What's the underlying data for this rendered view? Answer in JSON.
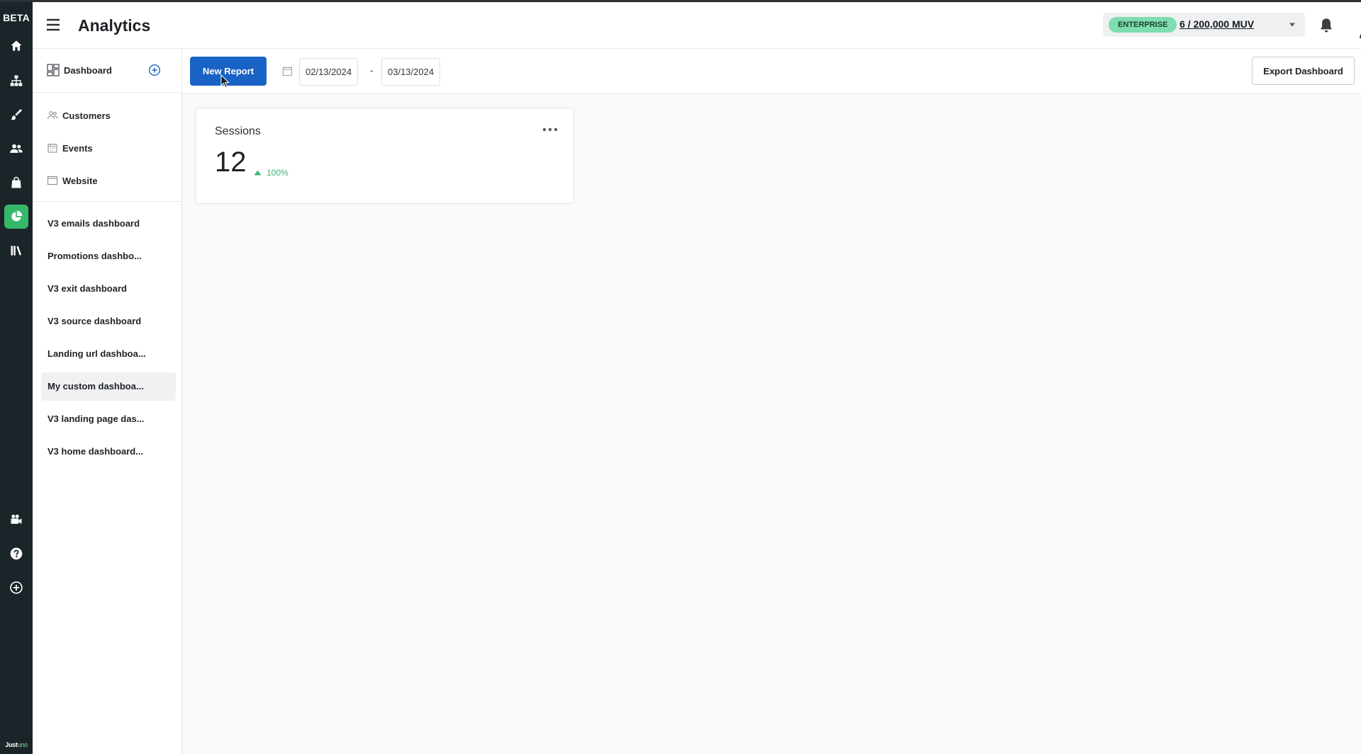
{
  "rail": {
    "beta_label": "BETA",
    "items": [
      {
        "icon": "home-icon"
      },
      {
        "icon": "sitemap-icon"
      },
      {
        "icon": "brush-icon"
      },
      {
        "icon": "users-icon"
      },
      {
        "icon": "shopping-bag-icon"
      },
      {
        "icon": "pie-chart-icon",
        "active": true
      },
      {
        "icon": "library-icon"
      }
    ],
    "bottom_items": [
      {
        "icon": "video-camera-icon"
      },
      {
        "icon": "help-icon"
      },
      {
        "icon": "plus-circle-icon"
      }
    ],
    "brand_bold": "Just",
    "brand_light": "uno"
  },
  "header": {
    "title": "Analytics",
    "plan_badge": "ENTERPRISE",
    "usage": "6 / 200,000 MUV"
  },
  "sidebar": {
    "dashboard_label": "Dashboard",
    "sections": [
      {
        "label": "Customers",
        "icon": "customers-icon"
      },
      {
        "label": "Events",
        "icon": "calendar-icon"
      },
      {
        "label": "Website",
        "icon": "browser-window-icon"
      }
    ],
    "dashboards": [
      {
        "label": "V3 emails dashboard"
      },
      {
        "label": "Promotions dashbo..."
      },
      {
        "label": "V3 exit dashboard"
      },
      {
        "label": "V3 source dashboard"
      },
      {
        "label": "Landing url dashboa..."
      },
      {
        "label": "My custom dashboa...",
        "selected": true
      },
      {
        "label": "V3 landing page das..."
      },
      {
        "label": "V3 home dashboard..."
      }
    ]
  },
  "toolbar": {
    "new_report_label": "New Report",
    "start_date": "02/13/2024",
    "date_separator": "-",
    "end_date": "03/13/2024",
    "export_label": "Export Dashboard"
  },
  "card": {
    "title": "Sessions",
    "value": "12",
    "change": "100%",
    "change_direction": "up"
  },
  "colors": {
    "primary": "#1a63c6",
    "accent_green": "#35b86a",
    "badge_green": "#7fdcae",
    "rail_bg": "#1b2428"
  }
}
